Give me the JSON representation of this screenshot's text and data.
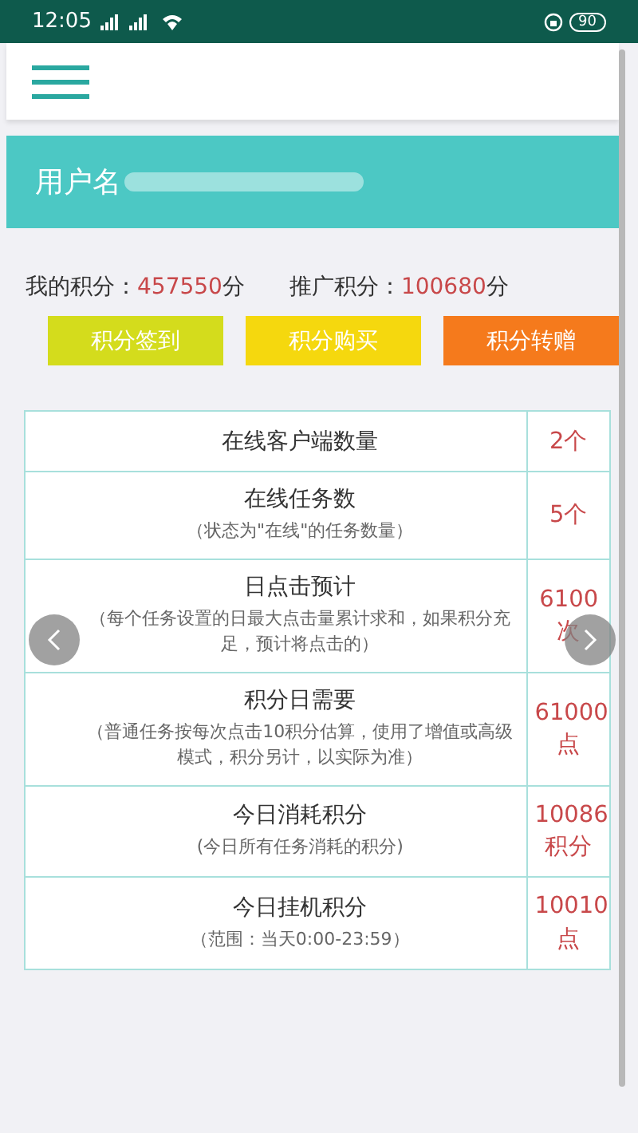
{
  "status_bar": {
    "time": "12:05",
    "battery": "90"
  },
  "banner": {
    "username_label": "用户名"
  },
  "points": [
    {
      "label": "我的积分：",
      "value": "457550",
      "unit": "分"
    },
    {
      "label": "推广积分：",
      "value": "100680",
      "unit": "分"
    }
  ],
  "buttons": [
    {
      "label": "积分签到",
      "color": "#d4dc1c"
    },
    {
      "label": "积分购买",
      "color": "#f5d80e"
    },
    {
      "label": "积分转赠",
      "color": "#f57a1c"
    }
  ],
  "table": {
    "rows": [
      {
        "title": "在线客户端数量",
        "value": "2个"
      },
      {
        "title": "在线任务数",
        "note": "（状态为\"在线\"的任务数量）",
        "value": "5个"
      },
      {
        "title": "日点击预计",
        "note": "（每个任务设置的日最大点击量累计求和，如果积分充足，预计将点击的）",
        "value": "6100次"
      },
      {
        "title": "积分日需要",
        "note": "（普通任务按每次点击10积分估算，使用了增值或高级模式，积分另计，以实际为准）",
        "value": "61000点"
      },
      {
        "title": "今日消耗积分",
        "note": "(今日所有任务消耗的积分)",
        "value": "10086积分"
      },
      {
        "title": "今日挂机积分",
        "note": "（范围：当天0:00-23:59）",
        "value": "10010点"
      }
    ]
  }
}
